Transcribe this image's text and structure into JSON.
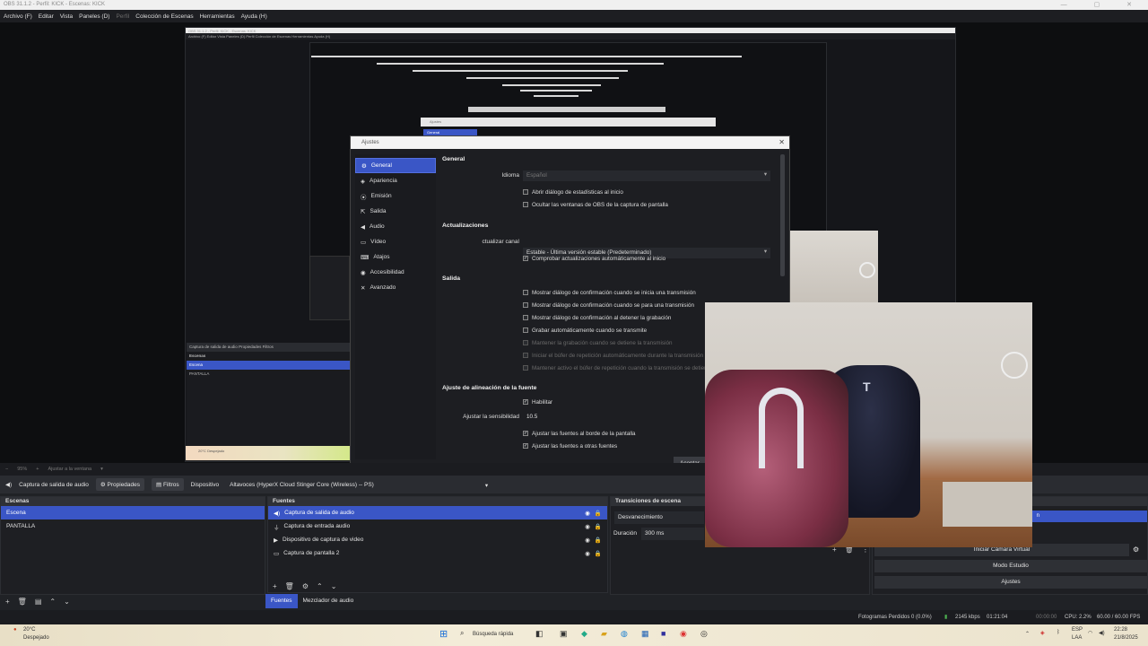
{
  "title_bar": {
    "text": "OBS 31.1.2 - Perfil: KICK - Escenas: KICK"
  },
  "menu": [
    {
      "label": "Archivo (F)",
      "enabled": true
    },
    {
      "label": "Editar",
      "enabled": true
    },
    {
      "label": "Vista",
      "enabled": true
    },
    {
      "label": "Paneles (D)",
      "enabled": true
    },
    {
      "label": "Perfil",
      "enabled": false
    },
    {
      "label": "Colección de Escenas",
      "enabled": true
    },
    {
      "label": "Herramientas",
      "enabled": true
    },
    {
      "label": "Ayuda (H)",
      "enabled": true
    }
  ],
  "preview_status": {
    "zoom": "95%",
    "fit": "Ajustar a la ventana"
  },
  "source_toolbar": {
    "source": "Captura de salida de audio",
    "properties": "Propiedades",
    "filters": "Filtros",
    "device_label": "Dispositivo",
    "device_value": "Altavoces (HyperX Cloud Stinger Core (Wireless) -- PS)"
  },
  "scenes": {
    "title": "Escenas",
    "items": [
      "Escena",
      "PANTALLA"
    ],
    "selected": 0
  },
  "sources": {
    "title": "Fuentes",
    "items": [
      "Captura de salida de audio",
      "Captura de entrada audio",
      "Dispositivo de captura de video",
      "Captura de pantalla 2"
    ],
    "selected": 0
  },
  "dock_tabs": [
    "Fuentes",
    "Mezclador de audio"
  ],
  "transitions": {
    "title": "Transiciones de escena",
    "value": "Desvanecimiento",
    "duration_label": "Duración",
    "duration_value": "300 ms"
  },
  "controls": {
    "virtual_camera": "Iniciar Cámara Virtual",
    "studio_mode": "Modo Estudio",
    "settings": "Ajustes",
    "partial_button": "n"
  },
  "status_bar": {
    "dropped_frames": "Fotogramas Perdidos 0 (0.0%)",
    "bitrate": "2145 kbps",
    "time1": "01:21:04",
    "time2": "00:00:00",
    "cpu": "CPU: 2.2%",
    "fps": "60.00 / 60.00 FPS"
  },
  "taskbar": {
    "weather_temp": "20°C",
    "weather_desc": "Despejado",
    "search_placeholder": "Búsqueda rápida",
    "lang1": "ESP",
    "lang2": "LAA",
    "clock_time": "22:28",
    "clock_date": "21/8/2025"
  },
  "settings_dialog": {
    "title": "Ajustes",
    "nav": [
      "General",
      "Apariencia",
      "Emisión",
      "Salida",
      "Audio",
      "Vídeo",
      "Atajos",
      "Accesibilidad",
      "Avanzado"
    ],
    "nav_icons": [
      "gear-icon",
      "palette-icon",
      "broadcast-icon",
      "output-icon",
      "speaker-icon",
      "monitor-icon",
      "keyboard-icon",
      "accessibility-icon",
      "wrench-icon"
    ],
    "selected_nav": 0,
    "general_title": "General",
    "language_label": "Idioma",
    "language_value": "Español",
    "cb_stats": "Abrir diálogo de estadísticas al inicio",
    "cb_hide_windows": "Ocultar las ventanas de OBS de la captura de pantalla",
    "updates_title": "Actualizaciones",
    "channel_label": "ctualizar canal",
    "channel_value": "Estable - Última versión estable (Predeterminado)",
    "cb_check_updates": "Comprobar actualizaciones automáticamente al inicio",
    "output_title": "Salida",
    "cb_confirm_start": "Mostrar diálogo de confirmación cuando se inicia una transmisión",
    "cb_confirm_stop": "Mostrar diálogo de confirmación cuando se para una transmisión",
    "cb_confirm_rec": "Mostrar diálogo de confirmación al detener la grabación",
    "cb_auto_record": "Grabar automáticamente cuando se transmite",
    "cb_keep_rec": "Mantener la grabación cuando se detiene la transmisión",
    "cb_replay_auto": "Iniciar el búfer de repetición automáticamente durante la transmisión",
    "cb_replay_keep": "Mantener activo el búfer de repetición cuando la transmisión se detiene",
    "snap_title": "Ajuste de alineación de la fuente",
    "cb_enable": "Habilitar",
    "sensitivity_label": "Ajustar la sensibilidad",
    "sensitivity_value": "10.5",
    "cb_snap_edge": "Ajustar las fuentes al borde de la pantalla",
    "cb_snap_sources": "Ajustar las fuentes a otras fuentes",
    "accept": "Aceptar"
  },
  "webcam": {
    "chair_brand": "T"
  },
  "nested": {
    "title": "OBS 31.1.2 - Perfil: KICK - Escenas: KICK",
    "menu": "Archivo (F)  Editar  Vista  Paneles (D)  Perfil  Colección de Escenas  Herramientas  Ayuda (H)",
    "dialog_title": "Ajustes",
    "dialog_nav": "General",
    "scenes_title": "Escenas",
    "scene1": "Escena",
    "scene2": "PANTALLA",
    "source": "Captura de salida de audio",
    "properties": "Propiedades",
    "filters": "Filtros",
    "device": "Dispositivo",
    "zoom": "95%",
    "fit": "Ajustar a la ventana",
    "weather_temp": "20°C",
    "weather_desc": "Despejado"
  },
  "colors": {
    "accent": "#3a56c6",
    "panel_bg": "#1e1f23",
    "window_bg": "#202226"
  }
}
